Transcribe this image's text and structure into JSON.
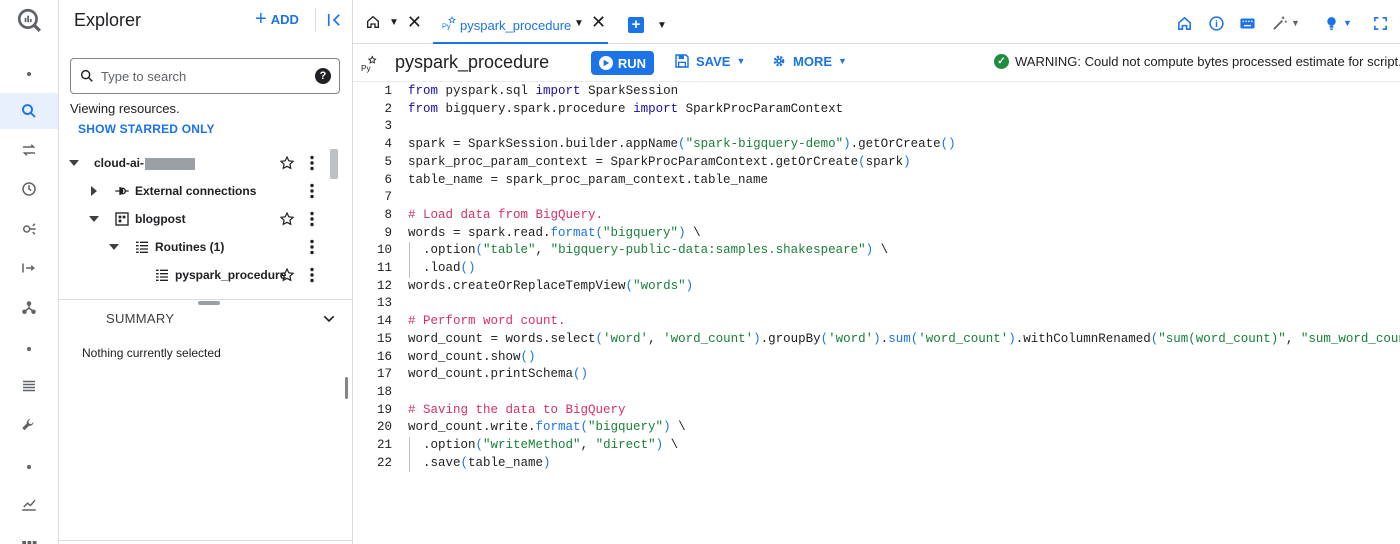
{
  "rail": {
    "items": [
      "bigquery-logo-icon",
      "dot-icon",
      "search-icon",
      "transfers-icon",
      "history-icon",
      "analytics-hub-icon",
      "dataflow-icon",
      "graph-icon",
      "dot-icon",
      "list-icon",
      "wrench-icon",
      "dot-icon",
      "chart-icon",
      "grid-icon"
    ]
  },
  "explorer": {
    "title": "Explorer",
    "add_label": "ADD",
    "search_placeholder": "Type to search",
    "help_glyph": "?",
    "viewing_text": "Viewing resources.",
    "starred_label": "SHOW STARRED ONLY",
    "tree": [
      {
        "label": "cloud-ai-",
        "redacted": true
      },
      {
        "label": "External connections"
      },
      {
        "label": "blogpost"
      },
      {
        "label": "Routines (1)"
      },
      {
        "label": "pyspark_procedure"
      }
    ],
    "summary_label": "SUMMARY",
    "nothing_selected": "Nothing currently selected"
  },
  "tabs": {
    "active_label": "pyspark_procedure"
  },
  "toolbar": {
    "procedure_name": "pyspark_procedure",
    "run_label": "RUN",
    "save_label": "SAVE",
    "more_label": "MORE",
    "warning_text": "WARNING: Could not compute bytes processed estimate for script."
  },
  "colors": {
    "accent": "#1a73e8",
    "success": "#1e8e3e",
    "comment": "#d93063",
    "string": "#188038"
  },
  "editor": {
    "lines": [
      [
        [
          "kw",
          "from"
        ],
        [
          "t",
          " pyspark.sql "
        ],
        [
          "kw",
          "import"
        ],
        [
          "t",
          " SparkSession"
        ]
      ],
      [
        [
          "kw",
          "from"
        ],
        [
          "t",
          " bigquery.spark.procedure "
        ],
        [
          "kw",
          "import"
        ],
        [
          "t",
          " SparkProcParamContext"
        ]
      ],
      [],
      [
        [
          "t",
          "spark = SparkSession.builder.appName"
        ],
        [
          "fn",
          "("
        ],
        [
          "st",
          "\"spark-bigquery-demo\""
        ],
        [
          "fn",
          ")"
        ],
        [
          "t",
          ".getOrCreate"
        ],
        [
          "fn",
          "()"
        ]
      ],
      [
        [
          "t",
          "spark_proc_param_context = SparkProcParamContext.getOrCreate"
        ],
        [
          "fn",
          "("
        ],
        [
          "t",
          "spark"
        ],
        [
          "fn",
          ")"
        ]
      ],
      [
        [
          "t",
          "table_name = spark_proc_param_context.table_name"
        ]
      ],
      [],
      [
        [
          "cm",
          "# Load data from BigQuery."
        ]
      ],
      [
        [
          "t",
          "words = spark.read."
        ],
        [
          "fn",
          "format("
        ],
        [
          "st",
          "\"bigquery\""
        ],
        [
          "fn",
          ")"
        ],
        [
          "t",
          " \\"
        ]
      ],
      [
        [
          "t",
          "  .option"
        ],
        [
          "fn",
          "("
        ],
        [
          "st",
          "\"table\""
        ],
        [
          "t",
          ", "
        ],
        [
          "st",
          "\"bigquery-public-data:samples.shakespeare\""
        ],
        [
          "fn",
          ")"
        ],
        [
          "t",
          " \\"
        ]
      ],
      [
        [
          "t",
          "  .load"
        ],
        [
          "fn",
          "()"
        ]
      ],
      [
        [
          "t",
          "words.createOrReplaceTempView"
        ],
        [
          "fn",
          "("
        ],
        [
          "st",
          "\"words\""
        ],
        [
          "fn",
          ")"
        ]
      ],
      [],
      [
        [
          "cm",
          "# Perform word count."
        ]
      ],
      [
        [
          "t",
          "word_count = words.select"
        ],
        [
          "fn",
          "("
        ],
        [
          "st",
          "'word'"
        ],
        [
          "t",
          ", "
        ],
        [
          "st",
          "'word_count'"
        ],
        [
          "fn",
          ")"
        ],
        [
          "t",
          ".groupBy"
        ],
        [
          "fn",
          "("
        ],
        [
          "st",
          "'word'"
        ],
        [
          "fn",
          ")"
        ],
        [
          "t",
          "."
        ],
        [
          "fn",
          "sum("
        ],
        [
          "st",
          "'word_count'"
        ],
        [
          "fn",
          ")"
        ],
        [
          "t",
          ".withColumnRenamed"
        ],
        [
          "fn",
          "("
        ],
        [
          "st",
          "\"sum(word_count)\""
        ],
        [
          "t",
          ", "
        ],
        [
          "st",
          "\"sum_word_count\""
        ],
        [
          "fn",
          ")"
        ]
      ],
      [
        [
          "t",
          "word_count.show"
        ],
        [
          "fn",
          "()"
        ]
      ],
      [
        [
          "t",
          "word_count.printSchema"
        ],
        [
          "fn",
          "()"
        ]
      ],
      [],
      [
        [
          "cm",
          "# Saving the data to BigQuery"
        ]
      ],
      [
        [
          "t",
          "word_count.write."
        ],
        [
          "fn",
          "format("
        ],
        [
          "st",
          "\"bigquery\""
        ],
        [
          "fn",
          ")"
        ],
        [
          "t",
          " \\"
        ]
      ],
      [
        [
          "t",
          "  .option"
        ],
        [
          "fn",
          "("
        ],
        [
          "st",
          "\"writeMethod\""
        ],
        [
          "t",
          ", "
        ],
        [
          "st",
          "\"direct\""
        ],
        [
          "fn",
          ")"
        ],
        [
          "t",
          " \\"
        ]
      ],
      [
        [
          "t",
          "  .save"
        ],
        [
          "fn",
          "("
        ],
        [
          "t",
          "table_name"
        ],
        [
          "fn",
          ")"
        ]
      ]
    ],
    "line_numbers": [
      "1",
      "2",
      "3",
      "4",
      "5",
      "6",
      "7",
      "8",
      "9",
      "10",
      "11",
      "12",
      "13",
      "14",
      "15",
      "16",
      "17",
      "18",
      "19",
      "20",
      "21",
      "22"
    ]
  }
}
